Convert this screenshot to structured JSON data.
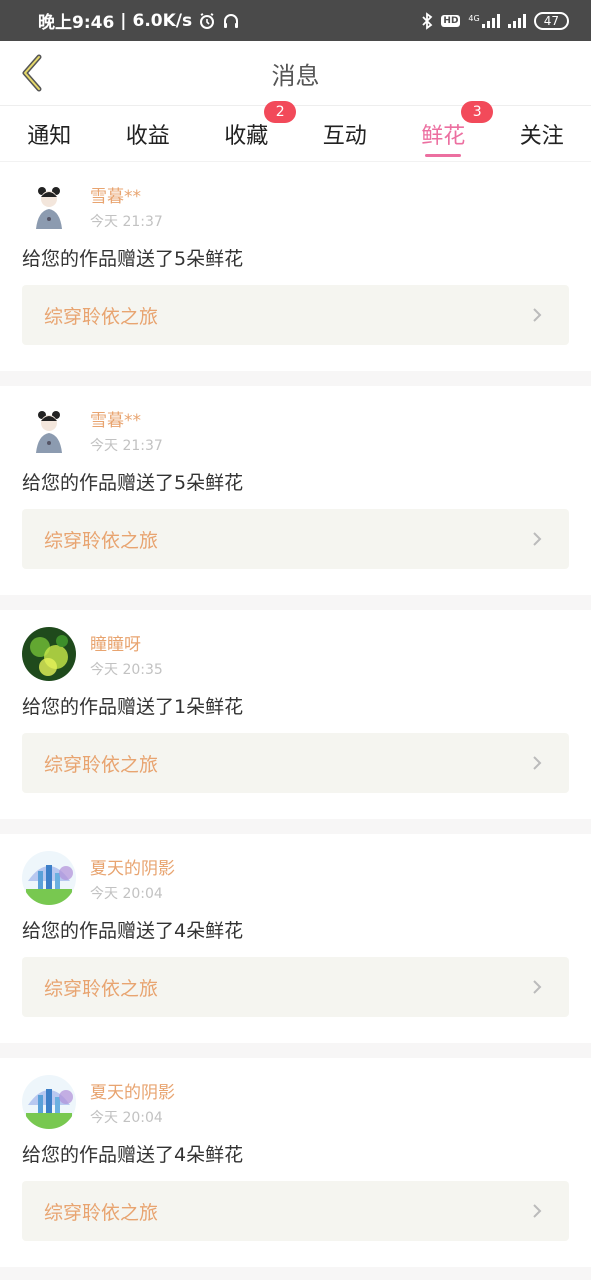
{
  "statusbar": {
    "time": "晚上9:46",
    "speed": "6.0K/s",
    "hd_label": "HD",
    "net_label": "4G",
    "battery": "47"
  },
  "header": {
    "title": "消息"
  },
  "tabs": [
    {
      "label": "通知",
      "badge": ""
    },
    {
      "label": "收益",
      "badge": ""
    },
    {
      "label": "收藏",
      "badge": "2"
    },
    {
      "label": "互动",
      "badge": ""
    },
    {
      "label": "鲜花",
      "badge": "3"
    },
    {
      "label": "关注",
      "badge": ""
    }
  ],
  "active_tab": "鲜花",
  "items": [
    {
      "user": "雪暮**",
      "time": "今天 21:37",
      "message": "给您的作品赠送了5朵鲜花",
      "work": "综穿聆依之旅"
    },
    {
      "user": "雪暮**",
      "time": "今天 21:37",
      "message": "给您的作品赠送了5朵鲜花",
      "work": "综穿聆依之旅"
    },
    {
      "user": "瞳瞳呀",
      "time": "今天 20:35",
      "message": "给您的作品赠送了1朵鲜花",
      "work": "综穿聆依之旅"
    },
    {
      "user": "夏天的阴影",
      "time": "今天 20:04",
      "message": "给您的作品赠送了4朵鲜花",
      "work": "综穿聆依之旅"
    },
    {
      "user": "夏天的阴影",
      "time": "今天 20:04",
      "message": "给您的作品赠送了4朵鲜花",
      "work": "综穿聆依之旅"
    }
  ],
  "colors": {
    "accent": "#ec6fa0",
    "username": "#e8a470",
    "badge": "#f24a5a"
  }
}
